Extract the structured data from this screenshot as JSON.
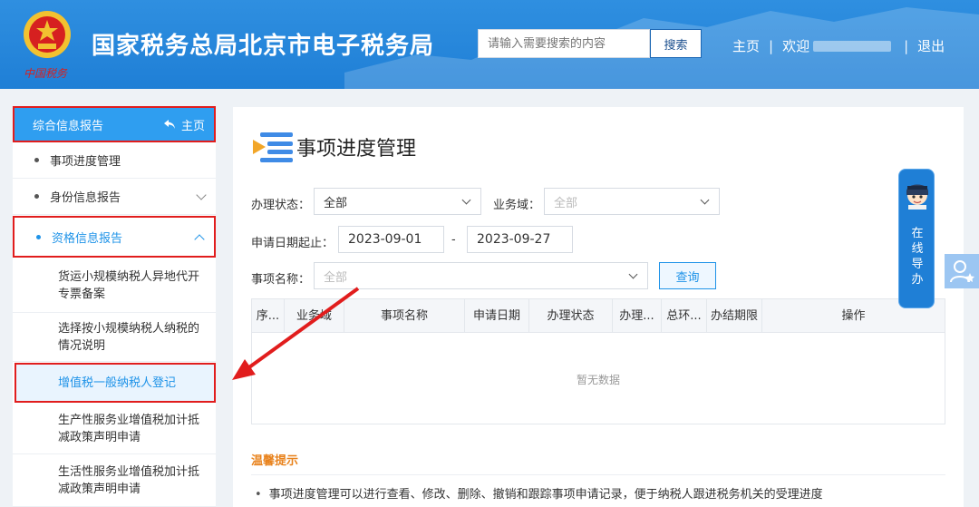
{
  "header": {
    "emblem_caption": "中国税务",
    "site_title": "国家税务总局北京市电子税务局",
    "search_placeholder": "请输入需要搜索的内容",
    "search_button": "搜索",
    "nav_home": "主页",
    "nav_sep": "|",
    "nav_welcome": "欢迎",
    "nav_logout": "退出"
  },
  "sidebar": {
    "head_label": "综合信息报告",
    "home_label": "主页",
    "items": [
      {
        "label": "事项进度管理"
      },
      {
        "label": "身份信息报告"
      },
      {
        "label": "资格信息报告"
      }
    ],
    "sub_items": [
      {
        "label": "货运小规模纳税人异地代开专票备案"
      },
      {
        "label": "选择按小规模纳税人纳税的情况说明"
      },
      {
        "label": "增值税一般纳税人登记"
      },
      {
        "label": "生产性服务业增值税加计抵减政策声明申请"
      },
      {
        "label": "生活性服务业增值税加计抵减政策声明申请"
      }
    ]
  },
  "main": {
    "page_title": "事项进度管理",
    "status_label": "办理状态：",
    "status_value": "全部",
    "domain_label": "业务域：",
    "domain_placeholder": "全部",
    "date_label": "申请日期起止：",
    "date_from": "2023-09-01",
    "date_dash": "-",
    "date_to": "2023-09-27",
    "item_label": "事项名称：",
    "item_placeholder": "全部",
    "query_button": "查询",
    "table": {
      "columns": [
        "序...",
        "业务域",
        "事项名称",
        "申请日期",
        "办理状态",
        "办理...",
        "总环...",
        "办结期限",
        "操作"
      ],
      "empty_text": "暂无数据"
    },
    "tips_title": "温馨提示",
    "tips": [
      "事项进度管理可以进行查看、修改、删除、撤销和跟踪事项申请记录，便于纳税人跟进税务机关的受理进度"
    ]
  },
  "guide": {
    "text": [
      "在",
      "线",
      "导",
      "办"
    ]
  },
  "colors": {
    "header_blue": "#1f7fd6",
    "accent_blue": "#1f93e8",
    "highlight_red": "#e11d1d",
    "tips_orange": "#e8821c"
  }
}
